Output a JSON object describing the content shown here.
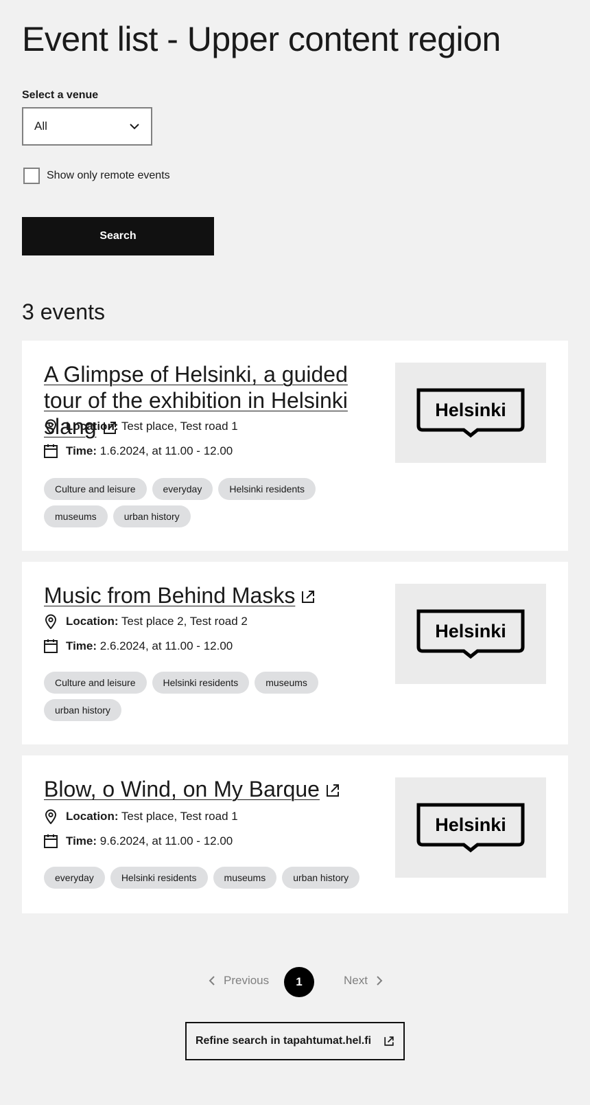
{
  "page": {
    "title": "Event list - Upper content region"
  },
  "filters": {
    "venue_label": "Select a venue",
    "venue_value": "All",
    "remote_label": "Show only remote events",
    "search_label": "Search"
  },
  "results": {
    "count_label": "3 events",
    "location_key": "Location:",
    "time_key": "Time:",
    "events": [
      {
        "title": "A Glimpse of Helsinki, a guided tour of the exhibition in Helsinki slang",
        "location": "Test place, Test road 1",
        "time": "1.6.2024, at 11.00 - 12.00",
        "tags": [
          "Culture and leisure",
          "everyday",
          "Helsinki residents",
          "museums",
          "urban history"
        ],
        "image_text": "Helsinki"
      },
      {
        "title": "Music from Behind Masks",
        "location": "Test place 2, Test road 2",
        "time": "2.6.2024, at 11.00 - 12.00",
        "tags": [
          "Culture and leisure",
          "Helsinki residents",
          "museums",
          "urban history"
        ],
        "image_text": "Helsinki"
      },
      {
        "title": "Blow, o Wind, on My Barque",
        "location": "Test place, Test road 1",
        "time": "9.6.2024, at 11.00 - 12.00",
        "tags": [
          "everyday",
          "Helsinki residents",
          "museums",
          "urban history"
        ],
        "image_text": "Helsinki"
      }
    ]
  },
  "pagination": {
    "previous": "Previous",
    "current": "1",
    "next": "Next"
  },
  "refine": {
    "label": "Refine search in tapahtumat.hel.fi"
  }
}
